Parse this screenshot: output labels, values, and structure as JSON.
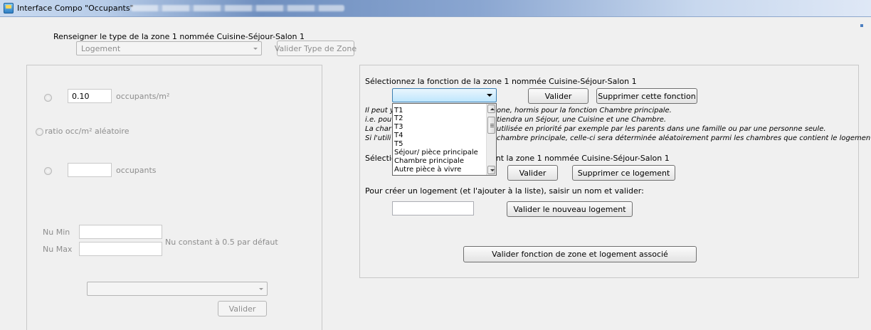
{
  "window": {
    "title": "Interface Compo \"Occupants\""
  },
  "zone_type": {
    "prompt": "Renseigner le type de la zone 1 nommée Cuisine-Séjour-Salon 1",
    "selected": "Logement",
    "validate_label": "Valider Type de Zone"
  },
  "left_panel": {
    "density_value": "0.10",
    "density_unit": "occupants/m²",
    "random_ratio_label": "ratio occ/m² aléatoire",
    "occupants_value": "",
    "occupants_unit": "occupants",
    "nu_min_label": "Nu Min",
    "nu_max_label": "Nu Max",
    "nu_min_value": "",
    "nu_max_value": "",
    "nu_note": "Nu constant à 0.5 par défaut",
    "combo_value": "",
    "validate_label": "Valider"
  },
  "function_panel": {
    "prompt": "Sélectionnez la fonction de la zone 1 nommée Cuisine-Séjour-Salon 1",
    "validate_label": "Valider",
    "delete_label": "Supprimer cette fonction",
    "notes": [
      {
        "left": "Il peut y",
        "right": "one, hormis pour la fonction Chambre principale."
      },
      {
        "left": "i.e. pou",
        "right": "tiendra un Séjour, une Cuisine et une Chambre."
      },
      {
        "left": "La char",
        "right": "utilisée en priorité par exemple par les parents dans une famille ou par une personne seule."
      },
      {
        "left": "Si l'utili",
        "right": "chambre principale, celle-ci sera déterminée aléatoirement parmi les chambres que contient le logement."
      }
    ],
    "dropdown_options": [
      "T1",
      "T2",
      "T3",
      "T4",
      "T5",
      "Séjour/ pièce principale",
      "Chambre principale",
      "Autre pièce à vivre"
    ]
  },
  "housing": {
    "prompt_left": "Sélectio",
    "prompt_right": "ent la zone 1 nommée Cuisine-Séjour-Salon 1",
    "validate_label": "Valider",
    "delete_label": "Supprimer ce logement",
    "create_prompt": "Pour créer un logement (et l'ajouter à la liste), saisir un nom et valider:",
    "new_name_value": "",
    "validate_new_label": "Valider le nouveau logement",
    "final_validate_label": "Valider fonction de zone et logement associé"
  }
}
